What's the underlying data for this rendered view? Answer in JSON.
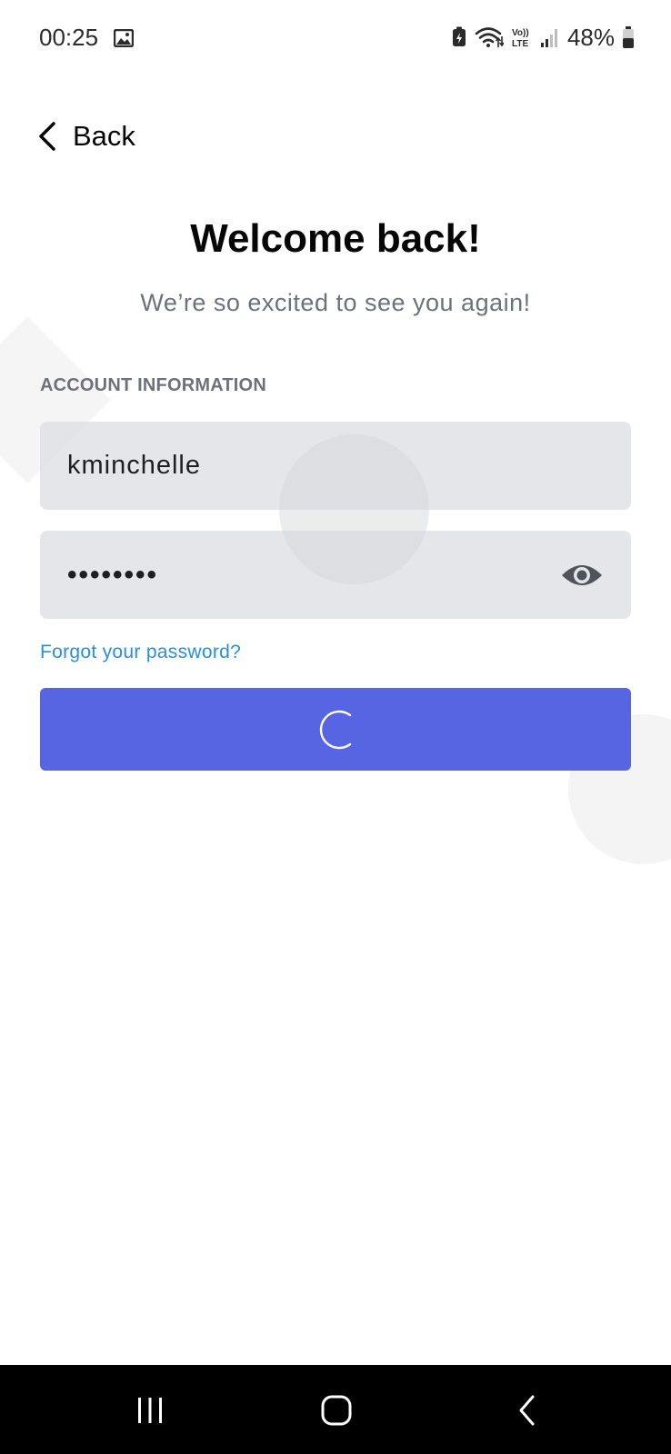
{
  "status_bar": {
    "time": "00:25",
    "battery_percent": "48%",
    "icons": [
      "gallery-icon",
      "battery-saver-icon",
      "wifi-icon",
      "volte-icon",
      "signal-icon",
      "battery-icon"
    ]
  },
  "header": {
    "back_label": "Back"
  },
  "main": {
    "title": "Welcome back!",
    "subtitle": "We’re so excited to see you again!",
    "section_label": "ACCOUNT INFORMATION",
    "username_value": "kminchelle",
    "password_masked": "••••••••",
    "forgot_link": "Forgot your password?",
    "login_state": "loading"
  },
  "colors": {
    "accent": "#5865e3",
    "link": "#2a8fd6",
    "input_bg": "#e3e5e8",
    "muted_text": "#6d717a"
  }
}
